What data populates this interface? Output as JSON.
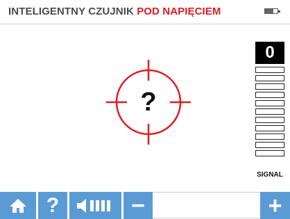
{
  "header": {
    "title_main": "INTELIGENTNY CZUJNIK",
    "title_alert": "POD NAPIĘCIEM",
    "battery_icon": "battery-icon"
  },
  "reticle": {
    "symbol": "?",
    "icon": "crosshair-icon",
    "color": "#e11b22"
  },
  "signal": {
    "value": "0",
    "label": "SIGNAL",
    "bars_total": 11,
    "bars_lit": 0
  },
  "toolbar": {
    "home_icon": "home-icon",
    "help_label": "?",
    "volume_icon": "volume-icon",
    "minus_label": "−",
    "plus_label": "+",
    "accent": "#5b9bd5"
  }
}
